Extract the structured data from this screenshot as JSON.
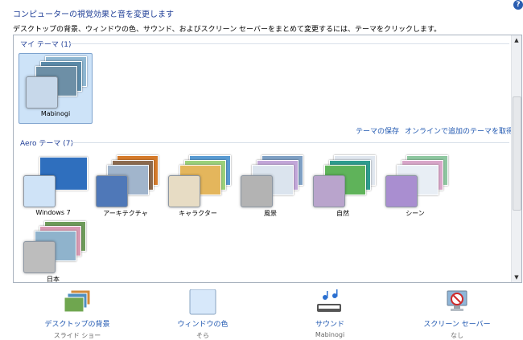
{
  "header": {
    "title": "コンピューターの視覚効果と音を変更します",
    "description": "デスクトップの背景、ウィンドウの色、サウンド、およびスクリーン セーバーをまとめて変更するには、テーマをクリックします。",
    "help_glyph": "?"
  },
  "my_themes": {
    "heading": "マイ テーマ (1)",
    "items": [
      {
        "label": "Mabinogi",
        "selected": true,
        "swatch_color": "#c7d8ea",
        "photo_color": "#6d8fa6"
      }
    ],
    "save_link": "テーマの保存",
    "online_link": "オンラインで追加のテーマを取得"
  },
  "aero_themes": {
    "heading": "Aero テーマ (7)",
    "items": [
      {
        "label": "Windows 7",
        "swatch_color": "#cfe3f7",
        "photo_color": "#2f6fbe"
      },
      {
        "label": "アーキテクチャ",
        "swatch_color": "#4f78b8",
        "photo_color": "#a1b5cc"
      },
      {
        "label": "キャラクター",
        "swatch_color": "#e7dcc4",
        "photo_color": "#5a9bd2"
      },
      {
        "label": "風景",
        "swatch_color": "#b3b3b3",
        "photo_color": "#7fa0c4"
      },
      {
        "label": "自然",
        "swatch_color": "#b9a4cc",
        "photo_color": "#5fb35a"
      },
      {
        "label": "シーン",
        "swatch_color": "#a98ed0",
        "photo_color": "#8ec7a0"
      },
      {
        "label": "日本",
        "swatch_color": "#bdbdbd",
        "photo_color": "#8fb3cc"
      }
    ]
  },
  "bottom_bar": {
    "items": [
      {
        "link": "デスクトップの背景",
        "value": "スライド ショー"
      },
      {
        "link": "ウィンドウの色",
        "value": "そら"
      },
      {
        "link": "サウンド",
        "value": "Mabinogi"
      },
      {
        "link": "スクリーン セーバー",
        "value": "なし"
      }
    ]
  },
  "scrollbar": {
    "up_glyph": "▲",
    "down_glyph": "▼"
  }
}
